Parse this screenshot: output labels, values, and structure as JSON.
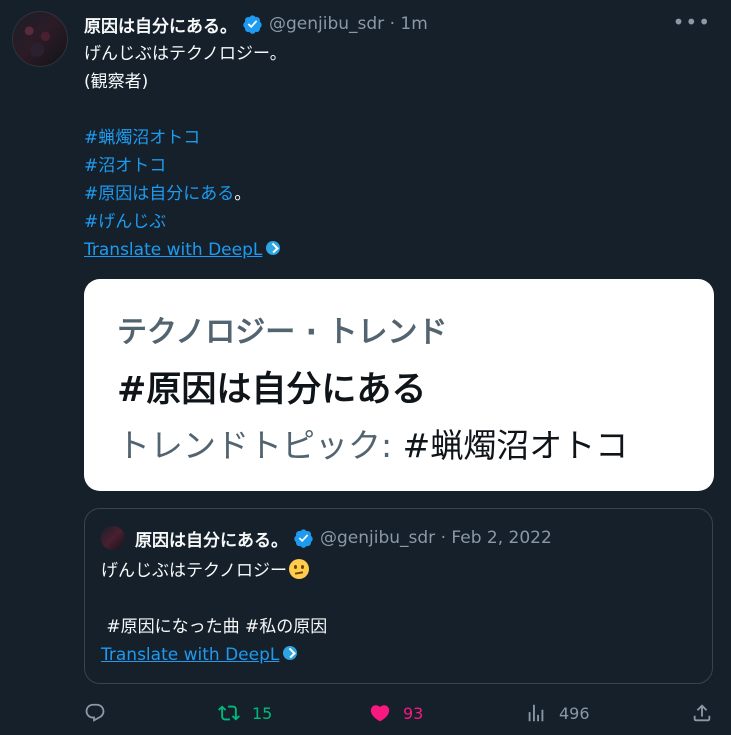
{
  "tweet": {
    "name": "原因は自分にある。",
    "handle_time": "@genjibu_sdr · 1m",
    "lines": [
      "げんじぶはテクノロジー。",
      "(観察者)",
      "",
      "#蝋燭沼オトコ",
      "#沼オトコ",
      "#原因は自分にある",
      "。",
      "#げんじぶ"
    ],
    "translate_label": "Translate with DeepL"
  },
  "card": {
    "line1": "テクノロジー · トレンド",
    "line2": "#原因は自分にある",
    "line3_prefix": "トレンドトピック: ",
    "line3_tag": "#蝋燭沼オトコ"
  },
  "quote": {
    "name": "原因は自分にある。",
    "handle_date": "@genjibu_sdr · Feb 2, 2022",
    "line1": "げんじぶはテクノロジー",
    "line3": " #原因になった曲 #私の原因",
    "translate_label": "Translate with DeepL"
  },
  "actions": {
    "retweets": "15",
    "likes": "93",
    "views": "496"
  },
  "colors": {
    "accent": "#1d9bf0",
    "retweet": "#00ba7c",
    "like": "#f91880",
    "background": "#15202b"
  },
  "icons": [
    "verified-badge-icon",
    "more-icon",
    "deepl-icon",
    "thinking-face-emoji",
    "reply-icon",
    "retweet-icon",
    "heart-icon",
    "views-icon",
    "share-icon"
  ]
}
